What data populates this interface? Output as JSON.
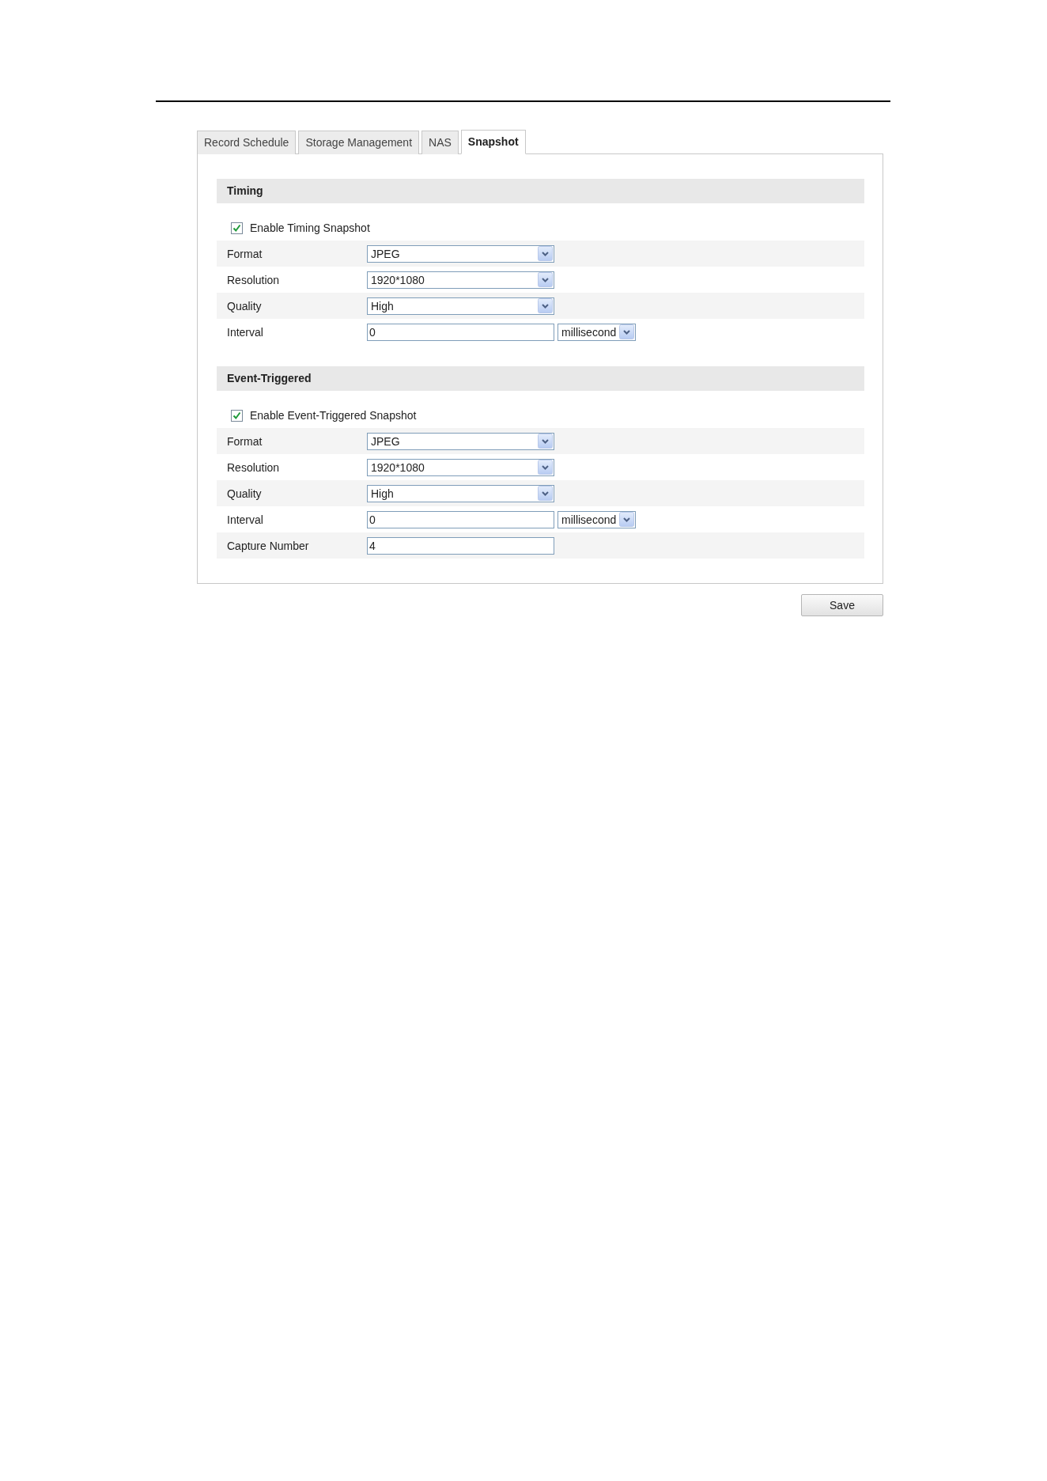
{
  "tabs": [
    {
      "label": "Record Schedule",
      "selected": false
    },
    {
      "label": "Storage Management",
      "selected": false
    },
    {
      "label": "NAS",
      "selected": false
    },
    {
      "label": "Snapshot",
      "selected": true
    }
  ],
  "sections": [
    {
      "title": "Timing",
      "enable": {
        "label": "Enable Timing Snapshot",
        "checked": true
      },
      "rows": [
        {
          "kind": "select",
          "label": "Format",
          "value": "JPEG"
        },
        {
          "kind": "select",
          "label": "Resolution",
          "value": "1920*1080"
        },
        {
          "kind": "select",
          "label": "Quality",
          "value": "High"
        },
        {
          "kind": "input_unit",
          "label": "Interval",
          "value": "0",
          "unit": "millisecond"
        }
      ]
    },
    {
      "title": "Event-Triggered",
      "enable": {
        "label": "Enable Event-Triggered Snapshot",
        "checked": true
      },
      "rows": [
        {
          "kind": "select",
          "label": "Format",
          "value": "JPEG"
        },
        {
          "kind": "select",
          "label": "Resolution",
          "value": "1920*1080"
        },
        {
          "kind": "select",
          "label": "Quality",
          "value": "High"
        },
        {
          "kind": "input_unit",
          "label": "Interval",
          "value": "0",
          "unit": "millisecond"
        },
        {
          "kind": "input",
          "label": "Capture Number",
          "value": "4"
        }
      ]
    }
  ],
  "save_button": "Save"
}
